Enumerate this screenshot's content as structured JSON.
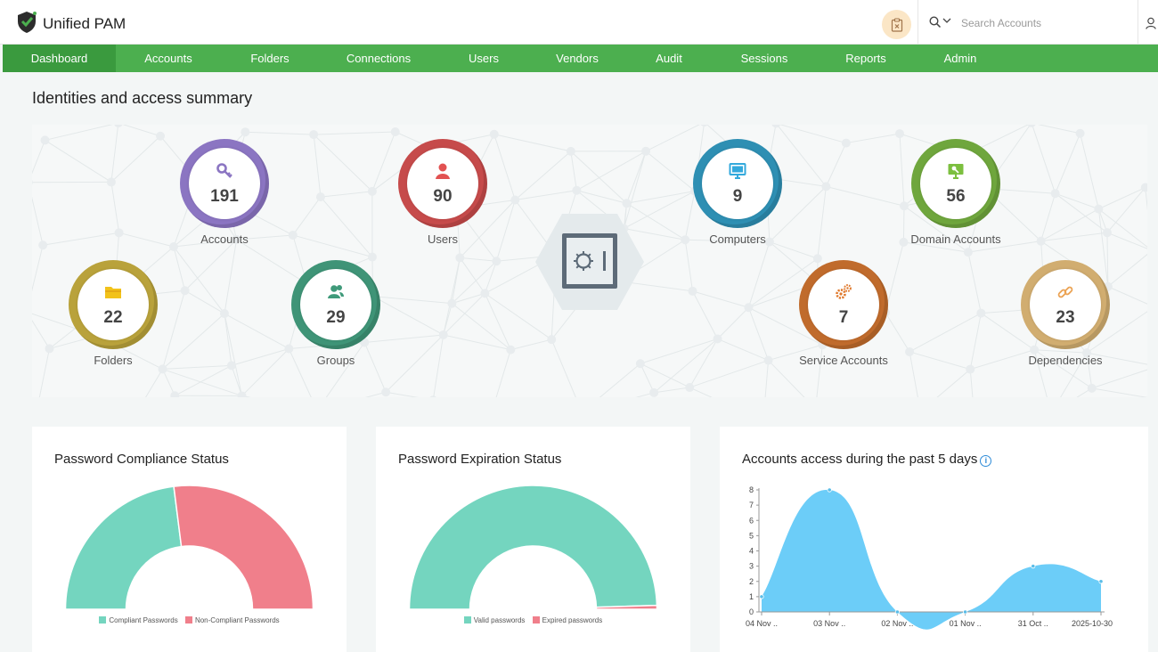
{
  "app": {
    "title": "Unified PAM"
  },
  "search": {
    "placeholder": "Search Accounts"
  },
  "icons": {
    "logo": "shield-check-icon",
    "tasks": "clipboard-x-icon",
    "search": "search-icon",
    "user": "user-icon"
  },
  "nav": {
    "items": [
      {
        "label": "Dashboard",
        "active": true
      },
      {
        "label": "Accounts"
      },
      {
        "label": "Folders"
      },
      {
        "label": "Connections"
      },
      {
        "label": "Users"
      },
      {
        "label": "Vendors"
      },
      {
        "label": "Audit"
      },
      {
        "label": "Sessions"
      },
      {
        "label": "Reports"
      },
      {
        "label": "Admin"
      }
    ]
  },
  "summary": {
    "title": "Identities and access summary",
    "stats": [
      {
        "label": "Accounts",
        "value": "191",
        "icon": "key-icon",
        "color": "#8b75c2",
        "iconColor": "#8b75c2"
      },
      {
        "label": "Users",
        "value": "90",
        "icon": "user-icon",
        "color": "#c64b4b",
        "iconColor": "#e25252"
      },
      {
        "label": "Computers",
        "value": "9",
        "icon": "monitor-icon",
        "color": "#2e8fb3",
        "iconColor": "#33a9dc"
      },
      {
        "label": "Domain Accounts",
        "value": "56",
        "icon": "domain-monitor-icon",
        "color": "#6fa63d",
        "iconColor": "#7cbf3f"
      },
      {
        "label": "Folders",
        "value": "22",
        "icon": "folder-icon",
        "color": "#b9a23b",
        "iconColor": "#f2c21a"
      },
      {
        "label": "Groups",
        "value": "29",
        "icon": "group-icon",
        "color": "#3f9477",
        "iconColor": "#3f9a7a"
      },
      {
        "label": "Service Accounts",
        "value": "7",
        "icon": "gears-icon",
        "color": "#c06b2c",
        "iconColor": "#e07a2e"
      },
      {
        "label": "Dependencies",
        "value": "23",
        "icon": "link-icon",
        "color": "#d1ad70",
        "iconColor": "#eba354"
      }
    ]
  },
  "chart_data": [
    {
      "type": "pie",
      "title": "Password Compliance Status",
      "subtype": "semi-donut",
      "categories": [
        "Compliant Passwords",
        "Non-Compliant Passwords"
      ],
      "values": [
        46,
        54
      ],
      "colors": [
        "#74d5bf",
        "#f07f8b"
      ],
      "legend": "bottom"
    },
    {
      "type": "pie",
      "title": "Password Expiration Status",
      "subtype": "semi-donut",
      "categories": [
        "Valid passwords",
        "Expired passwords"
      ],
      "values": [
        99,
        1
      ],
      "colors": [
        "#74d5bf",
        "#f07f8b"
      ],
      "legend": "bottom"
    },
    {
      "type": "area",
      "title": "Accounts access during the past 5 days",
      "categories": [
        "04 Nov ..",
        "03 Nov ..",
        "02 Nov ..",
        "01 Nov ..",
        "31 Oct ..",
        "2025-10-30"
      ],
      "values": [
        1,
        8,
        0,
        0,
        3,
        2
      ],
      "ylim": [
        0,
        8
      ],
      "yticks": [
        "0",
        "1",
        "2",
        "3",
        "4",
        "5",
        "6",
        "7",
        "8"
      ],
      "color": "#6ccdf8",
      "grid": false
    }
  ]
}
